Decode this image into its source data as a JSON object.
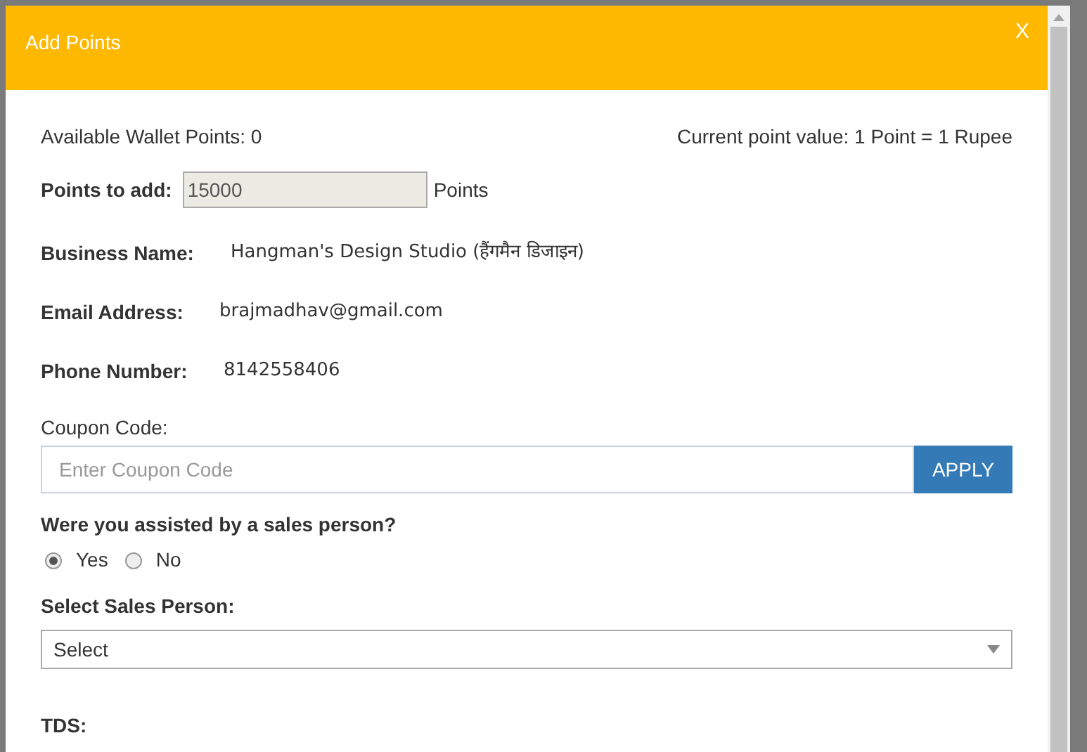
{
  "dialog": {
    "title": "Add Points",
    "close": "X"
  },
  "wallet": {
    "available": "Available Wallet Points: 0",
    "rate": "Current point value: 1 Point = 1 Rupee"
  },
  "points": {
    "label": "Points to add:",
    "value": "15000",
    "unit": "Points"
  },
  "details": [
    {
      "label": "Business Name:",
      "value": "Hangman's Design Studio (हैंगमैन डिजाइन)"
    },
    {
      "label": "Email Address:",
      "value": "brajmadhav@gmail.com"
    },
    {
      "label": "Phone Number:",
      "value": "8142558406"
    }
  ],
  "coupon": {
    "label": "Coupon Code:",
    "placeholder": "Enter Coupon Code",
    "button": "APPLY"
  },
  "assisted": {
    "question": "Were you assisted by a sales person?",
    "options": [
      {
        "label": "Yes",
        "selected": true
      },
      {
        "label": "No",
        "selected": false
      }
    ]
  },
  "sales_person": {
    "label": "Select Sales Person:",
    "value": "Select"
  },
  "tds": {
    "label": "TDS:"
  }
}
